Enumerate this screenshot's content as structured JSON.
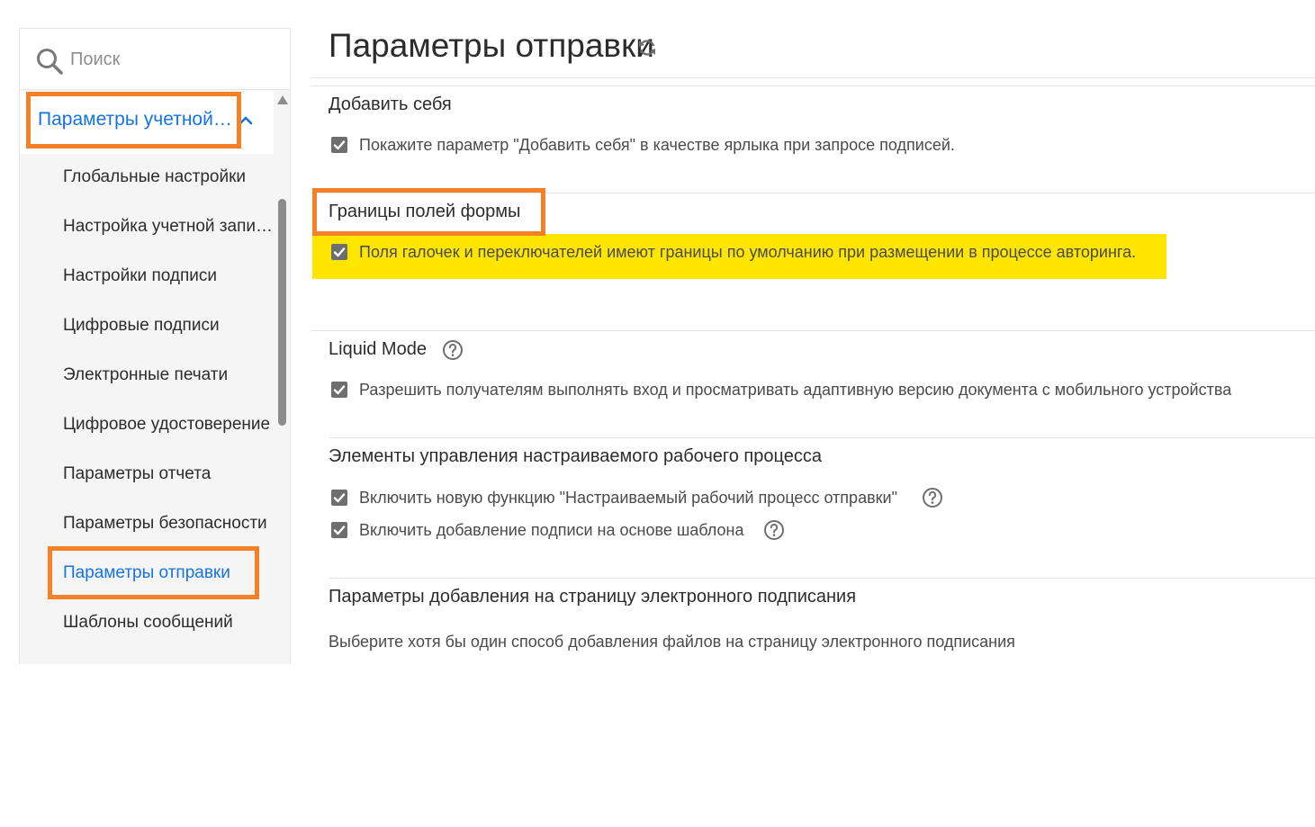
{
  "sidebar": {
    "search": {
      "placeholder": "Поиск",
      "value": ""
    },
    "group_label": "Параметры учетной…",
    "items": [
      {
        "label": "Глобальные настройки"
      },
      {
        "label": "Настройка учетной записи"
      },
      {
        "label": "Настройки подписи"
      },
      {
        "label": "Цифровые подписи"
      },
      {
        "label": "Электронные печати"
      },
      {
        "label": "Цифровое удостоверение"
      },
      {
        "label": "Параметры отчета"
      },
      {
        "label": "Параметры безопасности"
      },
      {
        "label": "Параметры отправки"
      },
      {
        "label": "Шаблоны сообщений"
      }
    ],
    "active_index": 8
  },
  "main": {
    "title": "Параметры отправки",
    "sections": {
      "add_self": {
        "title": "Добавить себя",
        "option": {
          "label": "Покажите параметр \"Добавить себя\" в качестве ярлыка при запросе подписей.",
          "checked": true
        }
      },
      "form_borders": {
        "title": "Границы полей формы",
        "option": {
          "label": "Поля галочек и переключателей имеют границы по умолчанию при размещении в процессе авторинга.",
          "checked": true
        }
      },
      "liquid_mode": {
        "title": "Liquid Mode",
        "option": {
          "label": "Разрешить получателям выполнять вход и просматривать адаптивную версию документа с мобильного устройства",
          "checked": true
        }
      },
      "workflow": {
        "title": "Элементы управления настраиваемого рабочего процесса",
        "options": [
          {
            "label": "Включить новую функцию \"Настраиваемый рабочий процесс отправки\"",
            "checked": true
          },
          {
            "label": "Включить добавление подписи на основе шаблона",
            "checked": true
          }
        ]
      },
      "esign_page": {
        "title": "Параметры добавления на страницу электронного подписания",
        "description": "Выберите хотя бы один способ добавления файлов на страницу электронного подписания"
      }
    }
  },
  "colors": {
    "accent_blue": "#1473e6",
    "highlight_orange": "#f58025",
    "highlight_yellow": "#ffe600",
    "checkbox_gray": "#6e6e6e"
  }
}
